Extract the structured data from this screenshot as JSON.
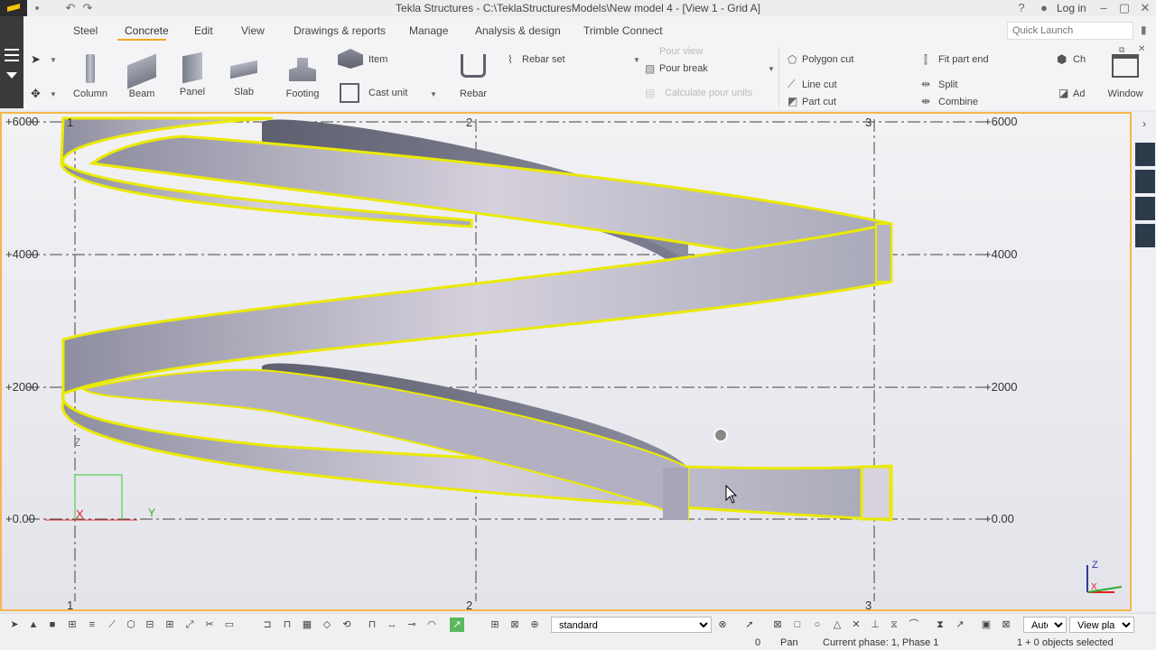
{
  "titlebar": {
    "title": "Tekla Structures - C:\\TeklaStructuresModels\\New model 4  - [View 1 - Grid A]",
    "login": "Log in"
  },
  "menu": {
    "tabs": [
      "Steel",
      "Concrete",
      "Edit",
      "View",
      "Drawings & reports",
      "Manage",
      "Analysis & design",
      "Trimble Connect"
    ],
    "active_tab": "Concrete",
    "quick_launch_placeholder": "Quick Launch"
  },
  "ribbon": {
    "column": "Column",
    "beam": "Beam",
    "panel": "Panel",
    "slab": "Slab",
    "footing": "Footing",
    "item": "Item",
    "cast_unit": "Cast unit",
    "rebar": "Rebar",
    "rebar_set": "Rebar set",
    "pour_view": "Pour view",
    "pour_break": "Pour break",
    "calculate_pour_units": "Calculate pour units",
    "polygon_cut": "Polygon cut",
    "line_cut": "Line cut",
    "part_cut": "Part cut",
    "fit_part_end": "Fit part end",
    "split": "Split",
    "combine": "Combine",
    "ch": "Ch",
    "ad": "Ad",
    "window": "Window"
  },
  "viewport": {
    "grid_labels_top": [
      "1",
      "2",
      "3"
    ],
    "grid_labels_bottom": [
      "1",
      "2",
      "3"
    ],
    "levels_left": [
      "+6000",
      "+4000",
      "+2000",
      "+0.00"
    ],
    "levels_right": [
      "+6000",
      "+4000",
      "+2000",
      "+0.00"
    ],
    "axis_z": "Z",
    "axis_x": "X",
    "axis_y": "Y"
  },
  "bottom": {
    "filter_value": "standard",
    "snap_mode": "Auto",
    "plane": "View plane"
  },
  "status": {
    "count": "0",
    "mode": "Pan",
    "phase": "Current phase: 1, Phase 1",
    "selection": "1 + 0 objects selected"
  },
  "colors": {
    "accent": "#f5a623",
    "highlight": "#f0f000",
    "part_face": "#bdbacc"
  }
}
